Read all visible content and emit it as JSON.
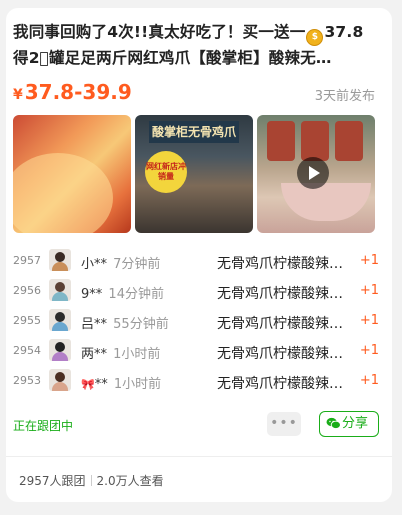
{
  "post": {
    "title_line1_a": "我同事回购了4次!!真太好吃了！买一送一",
    "title_line1_b": "37.8",
    "title_line2": "得2⃣罐足足两斤网红鸡爪【酸掌柜】酸辣无…",
    "coin_icon": "money-bag-emoji",
    "price_currency": "¥",
    "price_range": "37.8-39.9",
    "published": "3天前发布"
  },
  "images": [
    {
      "name": "spicy-chicken-feet-photo",
      "text": ""
    },
    {
      "name": "shop-front-photo",
      "sign": "酸掌柜无骨鸡爪",
      "badge": "网红新店冲销量"
    },
    {
      "name": "video-thumbnail",
      "play_icon": "play-icon"
    }
  ],
  "orders": [
    {
      "num": "2957",
      "user": "小**",
      "time": "7分钟前",
      "product": "无骨鸡爪柠檬酸辣…",
      "qty": "+1",
      "avatar_color": "#c98f5a"
    },
    {
      "num": "2956",
      "user": "9**",
      "time": "14分钟前",
      "product": "无骨鸡爪柠檬酸辣…",
      "qty": "+1",
      "avatar_color": "#7fb7c7"
    },
    {
      "num": "2955",
      "user": "吕**",
      "time": "55分钟前",
      "product": "无骨鸡爪柠檬酸辣…",
      "qty": "+1",
      "avatar_color": "#6aa7cf"
    },
    {
      "num": "2954",
      "user": "两**",
      "time": "1小时前",
      "product": "无骨鸡爪柠檬酸辣…",
      "qty": "+1",
      "avatar_color": "#b27fc7"
    },
    {
      "num": "2953",
      "user": "**",
      "user_prefix_icon": "bow-icon",
      "time": "1小时前",
      "product": "无骨鸡爪柠檬酸辣…",
      "qty": "+1",
      "avatar_color": "#d9a58c"
    }
  ],
  "actions": {
    "following": "正在跟团中",
    "more": "•••",
    "share": "分享"
  },
  "stats": {
    "joined": "2957人跟团",
    "views": "2.0万人查看"
  },
  "colors": {
    "accent": "#ff5b1f",
    "wechat_green": "#1aad19"
  }
}
